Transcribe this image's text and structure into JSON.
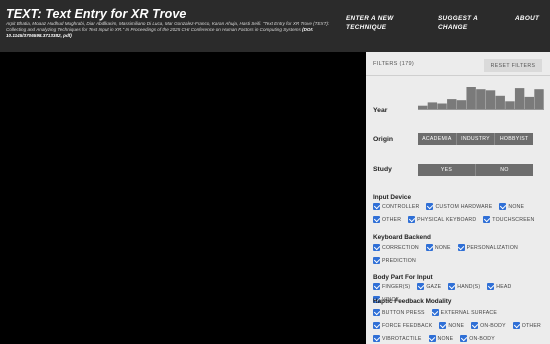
{
  "header": {
    "title": "TEXT: Text Entry for XR Trove",
    "citation_authors": "Arpit Bhatia, Moaaz Hudhud Mughrabi, Diar Abdlkarim, Massimiliano Di Luca, Mar Gonzalez-Franco, Karan Ahuja, Hasti Seifi. \"Text Entry for XR Trove (TEXT): Collecting and Analyzing Techniques for Text Input in XR.\" In Proceedings of the 2025 CHI Conference on Human Factors in Computing Systems",
    "citation_doi": "(DOI: 10.1145/3706598.3713382, pdf)",
    "nav": {
      "enter_technique": "ENTER A NEW TECHNIQUE",
      "suggest_change": "SUGGEST A CHANGE",
      "about": "ABOUT"
    }
  },
  "filters": {
    "count_label": "FILTERS (179)",
    "reset_label": "RESET FILTERS",
    "year_label": "Year",
    "year_histogram": [
      0.15,
      0.3,
      0.25,
      0.45,
      0.4,
      1.0,
      0.9,
      0.85,
      0.6,
      0.35,
      0.95,
      0.55,
      0.9
    ],
    "origin_label": "Origin",
    "origin_options": [
      "ACADEMIA",
      "INDUSTRY",
      "HOBBYIST"
    ],
    "study_label": "Study",
    "study_options": [
      "YES",
      "NO"
    ],
    "groups": [
      {
        "title": "Input Device",
        "items": [
          "CONTROLLER",
          "CUSTOM HARDWARE",
          "NONE",
          "OTHER",
          "PHYSICAL KEYBOARD",
          "TOUCHSCREEN"
        ]
      },
      {
        "title": "Keyboard Backend",
        "items": [
          "CORRECTION",
          "NONE",
          "PERSONALIZATION",
          "PREDICTION"
        ]
      },
      {
        "title": "Body Part For Input",
        "items": [
          "FINGER(S)",
          "GAZE",
          "HAND(S)",
          "HEAD",
          "VOICE"
        ]
      },
      {
        "title": "Haptic Feedback Modality",
        "items": [
          "BUTTON PRESS",
          "EXTERNAL SURFACE",
          "FORCE FEEDBACK",
          "NONE",
          "ON-BODY",
          "OTHER",
          "VIBROTACTILE",
          "NONE",
          "ON-BODY"
        ]
      }
    ]
  },
  "colors": {
    "header_bg": "#2b2b2b",
    "panel_bg": "#ececec",
    "checkbox": "#2f6fd6",
    "segment": "#6d6d6d"
  }
}
